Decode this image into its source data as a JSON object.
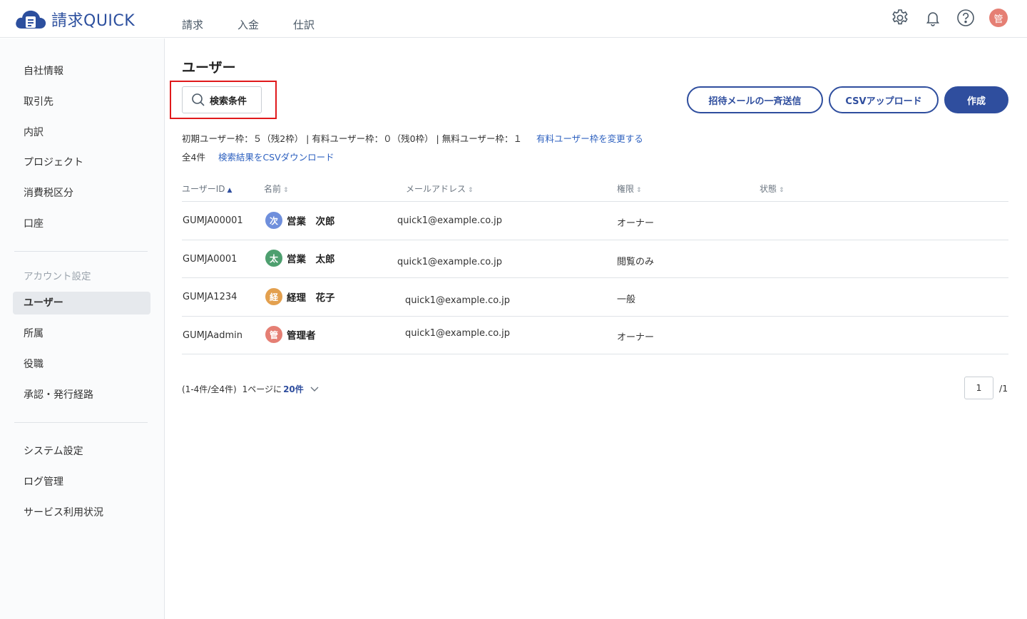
{
  "app": {
    "logo_text": "請求QUICK",
    "brand_color": "#2c4f9e",
    "accent_color": "#2f4e9e"
  },
  "topnav": {
    "items": [
      {
        "label": "請求"
      },
      {
        "label": "入金"
      },
      {
        "label": "仕訳"
      }
    ]
  },
  "header_icons": {
    "settings": "gear-icon",
    "notifications": "bell-icon",
    "help": "help-icon",
    "avatar_text": "管"
  },
  "sidebar": {
    "group1": [
      {
        "label": "自社情報"
      },
      {
        "label": "取引先"
      },
      {
        "label": "内訳"
      },
      {
        "label": "プロジェクト"
      },
      {
        "label": "消費税区分"
      },
      {
        "label": "口座"
      }
    ],
    "account_section_label": "アカウント設定",
    "group2": [
      {
        "label": "ユーザー",
        "active": true
      },
      {
        "label": "所属"
      },
      {
        "label": "役職"
      },
      {
        "label": "承認・発行経路"
      }
    ],
    "group3": [
      {
        "label": "システム設定"
      },
      {
        "label": "ログ管理"
      },
      {
        "label": "サービス利用状況"
      }
    ]
  },
  "main": {
    "title": "ユーザー",
    "search_button": "検索条件",
    "invite_button": "招待メールの一斉送信",
    "csv_upload_button": "CSVアップロード",
    "create_button": "作成",
    "quota_text": "初期ユーザー枠：５（残2枠） | 有料ユーザー枠：０（残0枠） | 無料ユーザー枠：１",
    "quota_link": "有料ユーザー枠を変更する",
    "count_text": "全4件",
    "csv_download_link": "検索結果をCSVダウンロード"
  },
  "table": {
    "headers": {
      "user_id": "ユーザーID",
      "name": "名前",
      "email": "メールアドレス",
      "role": "権限",
      "status": "状態"
    },
    "rows": [
      {
        "user_id": "GUMJA00001",
        "avatar": "次",
        "avatar_color": "#6f8fdc",
        "name": "営業　次郎",
        "email": "quick1@example.co.jp",
        "role": "オーナー"
      },
      {
        "user_id": "GUMJA0001",
        "avatar": "太",
        "avatar_color": "#4e9f6f",
        "name": "営業　太郎",
        "email": "quick1@example.co.jp",
        "role": "閲覧のみ"
      },
      {
        "user_id": "GUMJA1234",
        "avatar": "経",
        "avatar_color": "#e3a04e",
        "name": "経理　花子",
        "email": "quick1@example.co.jp",
        "role": "一般"
      },
      {
        "user_id": "GUMJAadmin",
        "avatar": "管",
        "avatar_color": "#e57f74",
        "name": "管理者",
        "email": "quick1@example.co.jp",
        "role": "オーナー"
      }
    ]
  },
  "pagination": {
    "range_text": "(1-4件/全4件)",
    "per_page_prefix": "1ページに",
    "per_page_value": "20件",
    "current_page": "1",
    "total_pages": "/1"
  }
}
